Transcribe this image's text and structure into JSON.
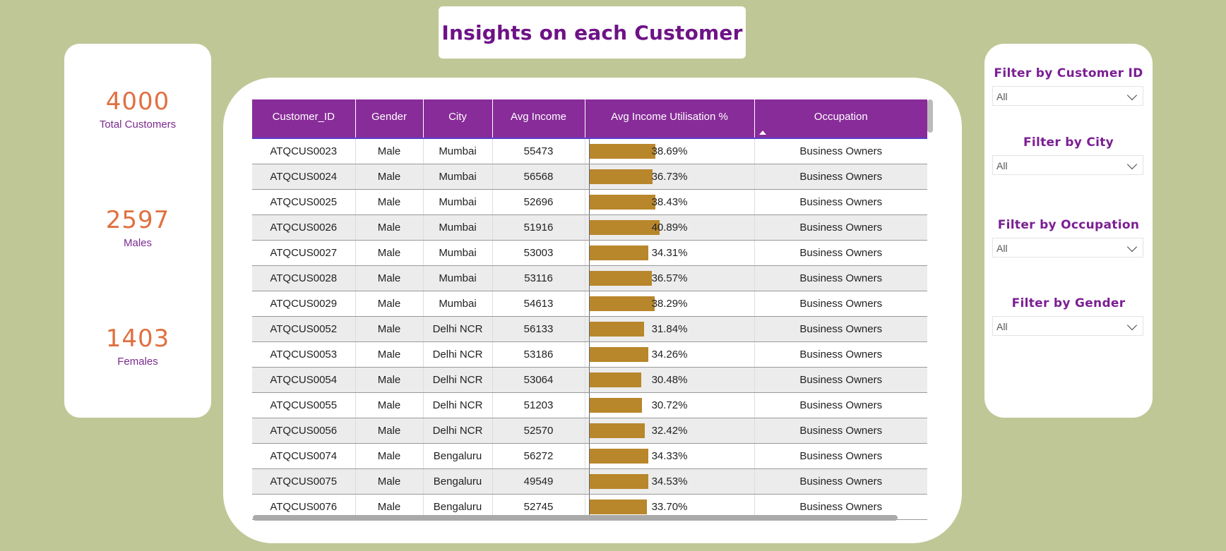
{
  "title": "Insights on each Customer",
  "kpis": [
    {
      "value": "4000",
      "label": "Total Customers"
    },
    {
      "value": "2597",
      "label": "Males"
    },
    {
      "value": "1403",
      "label": "Females"
    }
  ],
  "table": {
    "columns": [
      "Customer_ID",
      "Gender",
      "City",
      "Avg Income",
      "Avg Income Utilisation %",
      "Occupation"
    ],
    "rows": [
      [
        "ATQCUS0023",
        "Male",
        "Mumbai",
        "55473",
        "38.69%",
        "Business Owners"
      ],
      [
        "ATQCUS0024",
        "Male",
        "Mumbai",
        "56568",
        "36.73%",
        "Business Owners"
      ],
      [
        "ATQCUS0025",
        "Male",
        "Mumbai",
        "52696",
        "38.43%",
        "Business Owners"
      ],
      [
        "ATQCUS0026",
        "Male",
        "Mumbai",
        "51916",
        "40.89%",
        "Business Owners"
      ],
      [
        "ATQCUS0027",
        "Male",
        "Mumbai",
        "53003",
        "34.31%",
        "Business Owners"
      ],
      [
        "ATQCUS0028",
        "Male",
        "Mumbai",
        "53116",
        "36.57%",
        "Business Owners"
      ],
      [
        "ATQCUS0029",
        "Male",
        "Mumbai",
        "54613",
        "38.29%",
        "Business Owners"
      ],
      [
        "ATQCUS0052",
        "Male",
        "Delhi NCR",
        "56133",
        "31.84%",
        "Business Owners"
      ],
      [
        "ATQCUS0053",
        "Male",
        "Delhi NCR",
        "53186",
        "34.26%",
        "Business Owners"
      ],
      [
        "ATQCUS0054",
        "Male",
        "Delhi NCR",
        "53064",
        "30.48%",
        "Business Owners"
      ],
      [
        "ATQCUS0055",
        "Male",
        "Delhi NCR",
        "51203",
        "30.72%",
        "Business Owners"
      ],
      [
        "ATQCUS0056",
        "Male",
        "Delhi NCR",
        "52570",
        "32.42%",
        "Business Owners"
      ],
      [
        "ATQCUS0074",
        "Male",
        "Bengaluru",
        "56272",
        "34.33%",
        "Business Owners"
      ],
      [
        "ATQCUS0075",
        "Male",
        "Bengaluru",
        "49549",
        "34.53%",
        "Business Owners"
      ],
      [
        "ATQCUS0076",
        "Male",
        "Bengaluru",
        "52745",
        "33.70%",
        "Business Owners"
      ]
    ],
    "bar_max_percent": 47,
    "bar_color": "#b8862b",
    "header_color": "#882c99"
  },
  "filters": [
    {
      "title": "Filter by Customer ID",
      "value": "All"
    },
    {
      "title": "Filter by City",
      "value": "All"
    },
    {
      "title": "Filter by Occupation",
      "value": "All"
    },
    {
      "title": "Filter by Gender",
      "value": "All"
    }
  ]
}
